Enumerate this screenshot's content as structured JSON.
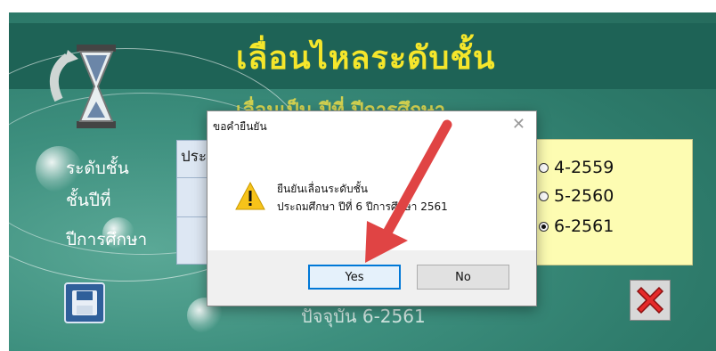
{
  "app": {
    "title": "เลื่อนไหลระดับชั้น",
    "subtitle": "เลื่อนเป็น ปีที่ ปีการศึกษา",
    "labels": {
      "level": "ระดับชั้น",
      "grade": "ชั้นปีที่",
      "year": "ปีการศึกษา"
    },
    "field_level_value": "ประ",
    "year_options": [
      {
        "label": "4-2559",
        "selected": false
      },
      {
        "label": "5-2560",
        "selected": false
      },
      {
        "label": "6-2561",
        "selected": true
      }
    ],
    "status_text": "ปัจจุบัน 6-2561"
  },
  "dialog": {
    "title": "ขอคำยืนยัน",
    "close_glyph": "✕",
    "message_line1": "ยืนยันเลื่อนระดับชั้น",
    "message_line2": "ประถมศึกษา ปีที่ 6 ปีการศึกษา 2561",
    "yes_label": "Yes",
    "no_label": "No",
    "icon": "warning-icon"
  },
  "colors": {
    "accent": "#0078d7",
    "title": "#f5e62b",
    "arrow": "#e04444"
  }
}
